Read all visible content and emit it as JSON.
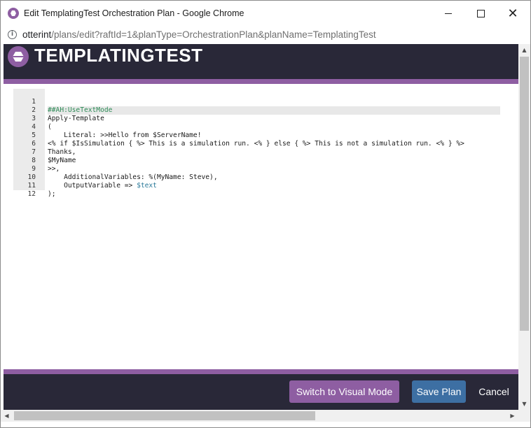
{
  "window": {
    "title": "Edit TemplatingTest Orchestration Plan - Google Chrome",
    "minimize_glyph": "",
    "maximize_glyph": "",
    "close_glyph": "✕"
  },
  "address_bar": {
    "host": "otterint",
    "path": "/plans/edit?raftId=1&planType=OrchestrationPlan&planName=TemplatingTest",
    "info_glyph": "i"
  },
  "header": {
    "title": "TEMPLATINGTEST"
  },
  "editor": {
    "lines": [
      {
        "num": "1",
        "text": "##AH:UseTextMode"
      },
      {
        "num": "2",
        "text": "Apply-Template"
      },
      {
        "num": "3",
        "text": "("
      },
      {
        "num": "4",
        "text": "    Literal: >>Hello from $ServerName!"
      },
      {
        "num": "5",
        "text": "<% if $IsSimulation { %> This is a simulation run. <% } else { %> This is not a simulation run. <% } %>"
      },
      {
        "num": "6",
        "text": "Thanks,"
      },
      {
        "num": "7",
        "text": "$MyName"
      },
      {
        "num": "8",
        "text": ">>,"
      },
      {
        "num": "9",
        "text": "    AdditionalVariables: %(MyName: Steve),"
      },
      {
        "num": "10",
        "text_prefix": "    OutputVariable => ",
        "text_var": "$text"
      },
      {
        "num": "11",
        "text": ");"
      },
      {
        "num": "12",
        "text": ""
      }
    ]
  },
  "footer": {
    "switch_label": "Switch to Visual Mode",
    "save_label": "Save Plan",
    "cancel_label": "Cancel"
  },
  "colors": {
    "brand_purple": "#8e5ea2",
    "header_dark": "#292838",
    "save_blue": "#3d6fa3"
  }
}
